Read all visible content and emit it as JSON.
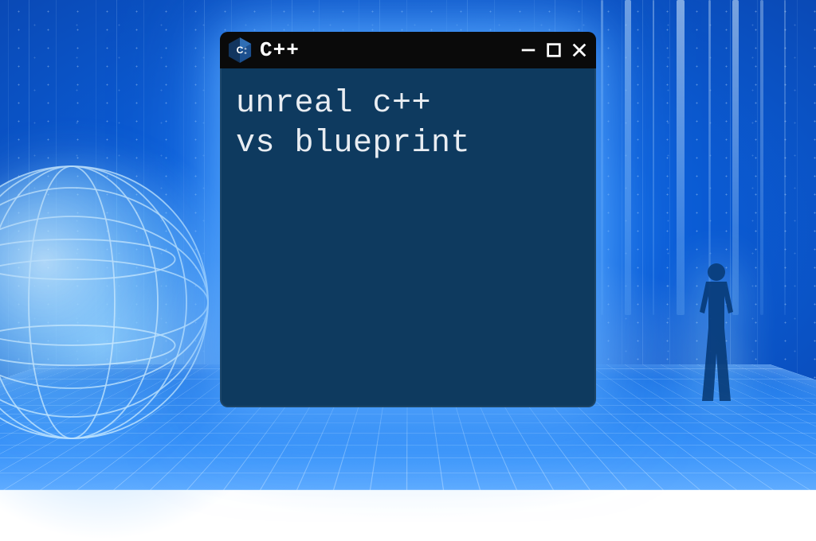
{
  "window": {
    "title": "C++",
    "icon": "cpp-icon",
    "controls": {
      "minimize": "minimize-icon",
      "maximize": "maximize-icon",
      "close": "close-icon"
    }
  },
  "content": {
    "headline": "unreal c++\nvs blueprint"
  },
  "colors": {
    "window_bg": "#0e3a5f",
    "titlebar_bg": "#0a0a0a",
    "text": "#e9edf2",
    "accent_blue": "#2a8fff"
  }
}
